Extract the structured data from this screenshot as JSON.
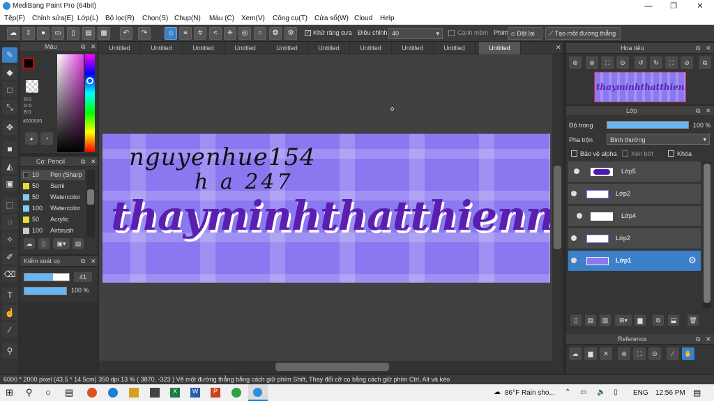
{
  "titlebar": {
    "title": "MediBang Paint Pro (64bit)",
    "min": "—",
    "max": "❐",
    "close": "✕"
  },
  "menu": [
    "Tệp(F)",
    "Chỉnh sửa(E)",
    "Lớp(L)",
    "Bộ lọc(R)",
    "Chọn(S)",
    "Chụp(N)",
    "Màu (C)",
    "Xem(V)",
    "Công cụ(T)",
    "Cửa sổ(W)",
    "Cloud",
    "Help"
  ],
  "toolbar": {
    "antialias": "Khử răng cưa",
    "adjust_label": "Điều chỉnh",
    "adjust_value": "40",
    "soft_edge": "Cạnh mềm",
    "key_label": "Phím",
    "reset": "Đặt lại",
    "straight_line": "Tạo một đường thẳng"
  },
  "color_panel": {
    "title": "Màu",
    "r": "R:0",
    "g": "G:0",
    "b": "B:0",
    "hex": "#000000"
  },
  "brush_panel": {
    "title": "Cọ: Pencil",
    "items": [
      {
        "size": "10",
        "name": "Pen (Sharp",
        "color": "#333333"
      },
      {
        "size": "50",
        "name": "Sumi",
        "color": "#e8e030"
      },
      {
        "size": "50",
        "name": "Watercolor",
        "color": "#7ad0f0"
      },
      {
        "size": "100",
        "name": "Watercolor",
        "color": "#7ad0f0"
      },
      {
        "size": "50",
        "name": "Acrylic",
        "color": "#e8e030"
      },
      {
        "size": "100",
        "name": "Airbrush",
        "color": "#cccccc"
      }
    ]
  },
  "brush_control": {
    "title": "Kiểm soát cọ",
    "size": "41",
    "opacity": "100 %"
  },
  "tabs": [
    "Untitled",
    "Untitled",
    "Untitled",
    "Untitled",
    "Untitled",
    "Untitled",
    "Untitled",
    "Untitled",
    "Untitled",
    "Untitled"
  ],
  "canvas": {
    "line1": "nguyenhue154",
    "line2": "h a 247",
    "main": "thayminhthatthiennang"
  },
  "navigator": {
    "title": "Hoa tiêu",
    "preview": "thayminhthatthiennang"
  },
  "layer_panel": {
    "title": "Lớp",
    "opacity_label": "Độ trong",
    "opacity_value": "100 %",
    "blend_label": "Pha trộn",
    "blend_value": "Bình thường",
    "protect_alpha": "Bảo vệ alpha",
    "clipping": "Xén bớt",
    "lock": "Khóa",
    "layers": [
      "Lớp5",
      "Lớp2",
      "Lớp4",
      "Lớp2",
      "Lớp1"
    ]
  },
  "reference": {
    "title": "Reference"
  },
  "status": "6000 * 2000 pixel   (43.5 * 14.5cm)   350 dpi   13 %   ( 3870, -323 )   Vẽ một đường thẳng bằng cách giữ phím Shift, Thay đổi cỡ cọ bằng cách giữ phím Ctrl, Alt và kéo",
  "taskbar": {
    "weather": "86°F  Rain sho...",
    "lang": "ENG",
    "time": "12:56 PM"
  }
}
